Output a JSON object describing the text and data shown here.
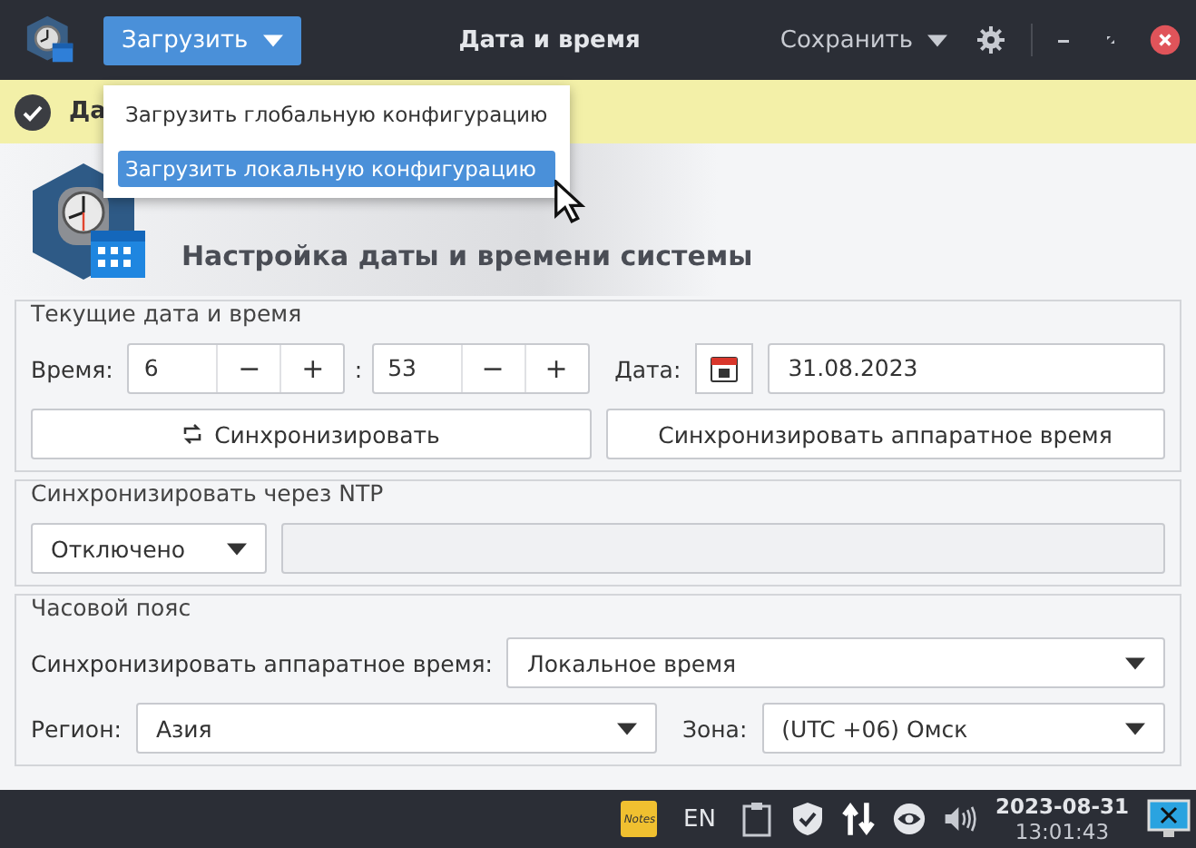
{
  "window": {
    "title": "Дата и время",
    "load_button": "Загрузить",
    "save_button": "Сохранить"
  },
  "load_menu": {
    "items": [
      {
        "label": "Загрузить глобальную конфигурацию",
        "selected": false
      },
      {
        "label": "Загрузить локальную конфигурацию",
        "selected": true
      }
    ]
  },
  "banner": {
    "text": "Да"
  },
  "header": {
    "subtitle": "Настройка даты и времени системы"
  },
  "current": {
    "title": "Текущие дата и время",
    "time_label": "Время:",
    "hours": "6",
    "minutes": "53",
    "separator": ":",
    "minus": "−",
    "plus": "+",
    "date_label": "Дата:",
    "date": "31.08.2023",
    "sync_button": "Синхронизировать",
    "hw_sync_button": "Синхронизировать аппаратное время"
  },
  "ntp": {
    "title": "Синхронизировать через NTP",
    "mode": "Отключено"
  },
  "timezone": {
    "title": "Часовой пояс",
    "hw_label": "Синхронизировать аппаратное время:",
    "hw_value": "Локальное время",
    "region_label": "Регион:",
    "region": "Азия",
    "zone_label": "Зона:",
    "zone": "(UTC +06) Омск"
  },
  "taskbar": {
    "notes": "Notes",
    "lang": "EN",
    "date": "2023-08-31",
    "time": "13:01:43"
  }
}
